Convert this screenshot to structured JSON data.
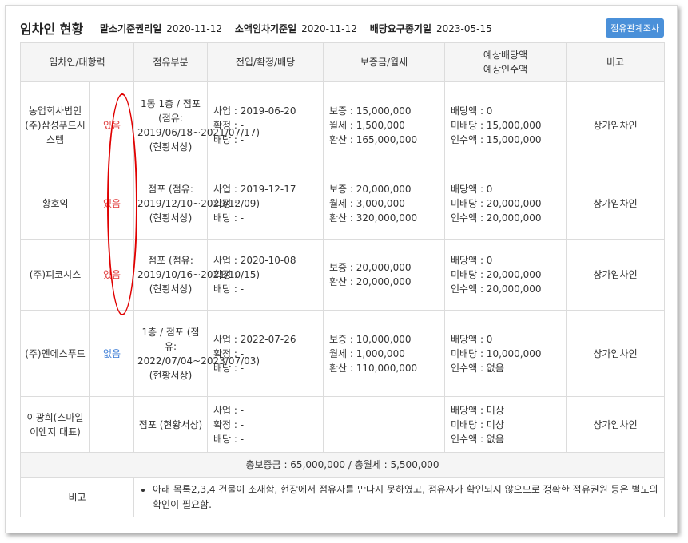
{
  "header": {
    "title": "임차인 현황",
    "malso_label": "말소기준권리일",
    "malso_value": "2020-11-12",
    "soaek_label": "소액임차기준일",
    "soaek_value": "2020-11-12",
    "baedang_label": "배당요구종기일",
    "baedang_value": "2023-05-15",
    "button_label": "점유관계조사"
  },
  "columns": {
    "tenant": "임차인/대항력",
    "occupancy": "점유부분",
    "move": "전입/확정/배당",
    "deposit": "보증금/월세",
    "expected_1": "예상배당액",
    "expected_2": "예상인수액",
    "note": "비고"
  },
  "rows": [
    {
      "name": "농업회사법인(주)삼성푸드시스템",
      "daehang": "있음",
      "occ": "1동 1층 / 점포 (점유: 2019/06/18~2021/07/17) (현황서상)",
      "m1": "사업 : 2019-06-20",
      "m2": "확정 : -",
      "m3": "배당 : -",
      "d1": "보증 : 15,000,000",
      "d2": "월세 : 1,500,000",
      "d3": "환산 : 165,000,000",
      "e1": "배당액 : 0",
      "e2": "미배당 : 15,000,000",
      "e3": "인수액 : 15,000,000",
      "note": "상가임차인"
    },
    {
      "name": "황호익",
      "daehang": "있음",
      "occ": "점포 (점유: 2019/12/10~2020/12/09) (현황서상)",
      "m1": "사업 : 2019-12-17",
      "m2": "확정 : -",
      "m3": "배당 : -",
      "d1": "보증 : 20,000,000",
      "d2": "월세 : 3,000,000",
      "d3": "환산 : 320,000,000",
      "e1": "배당액 : 0",
      "e2": "미배당 : 20,000,000",
      "e3": "인수액 : 20,000,000",
      "note": "상가임차인"
    },
    {
      "name": "(주)피코시스",
      "daehang": "있음",
      "occ": "점포 (점유: 2019/10/16~2021/10/15) (현황서상)",
      "m1": "사업 : 2020-10-08",
      "m2": "확정 : -",
      "m3": "배당 : -",
      "d1": "보증 : 20,000,000",
      "d2": "환산 : 20,000,000",
      "d3": "",
      "e1": "배당액 : 0",
      "e2": "미배당 : 20,000,000",
      "e3": "인수액 : 20,000,000",
      "note": "상가임차인"
    },
    {
      "name": "(주)엔에스푸드",
      "daehang": "없음",
      "occ": "1층 / 점포 (점유: 2022/07/04~2023/07/03) (현황서상)",
      "m1": "사업 : 2022-07-26",
      "m2": "확정 : -",
      "m3": "배당 : -",
      "d1": "보증 : 10,000,000",
      "d2": "월세 : 1,000,000",
      "d3": "환산 : 110,000,000",
      "e1": "배당액 : 0",
      "e2": "미배당 : 10,000,000",
      "e3": "인수액 : 없음",
      "note": "상가임차인"
    },
    {
      "name": "이광희(스마일이엔지 대표)",
      "daehang": "",
      "occ": "점포 (현황서상)",
      "m1": "사업 : -",
      "m2": "확정 : -",
      "m3": "배당 : -",
      "d1": "",
      "d2": "",
      "d3": "",
      "e1": "배당액 : 미상",
      "e2": "미배당 : 미상",
      "e3": "인수액 : 없음",
      "note": "상가임차인"
    }
  ],
  "summary": "총보증금 : 65,000,000  /  총월세 : 5,500,000",
  "remark": {
    "label": "비고",
    "text": "아래 목록2,3,4 건물이 소재함, 현장에서 점유자를 만나지 못하였고, 점유자가 확인되지 않으므로 정확한 점유권원 등은 별도의 확인이 필요함."
  },
  "colors": {
    "daehang_yes": "#e03b3b",
    "daehang_no": "#3a7bd5",
    "button": "#4a90d9",
    "annotation": "#e00000"
  }
}
